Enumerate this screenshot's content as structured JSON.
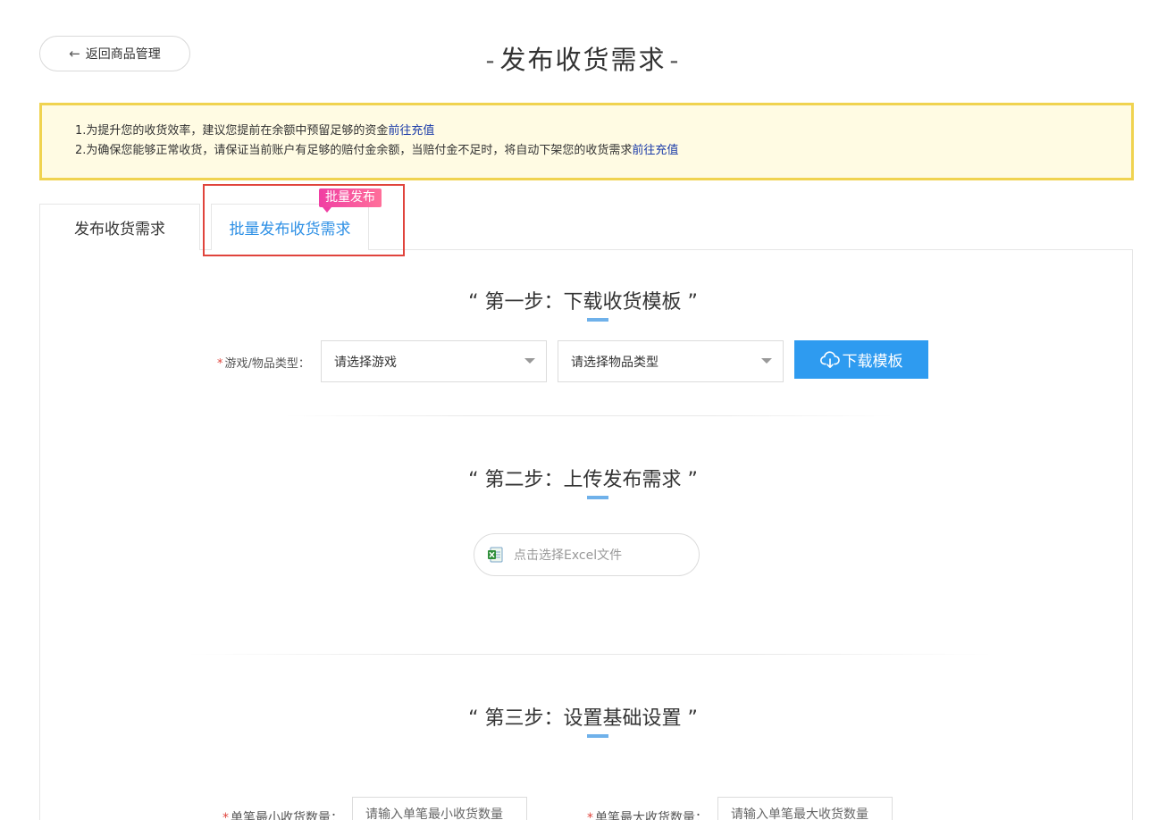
{
  "header": {
    "back_label": "返回商品管理",
    "title": "发布收货需求",
    "title_dash": "-"
  },
  "notice": {
    "line1_text": "1.为提升您的收货效率，建议您提前在余额中预留足够的资金",
    "line1_link": "前往充值",
    "line2_text": "2.为确保您能够正常收货，请保证当前账户有足够的赔付金余额，当赔付金不足时，将自动下架您的收货需求",
    "line2_link": "前往充值"
  },
  "tabs": [
    {
      "label": "发布收货需求",
      "active": false
    },
    {
      "label": "批量发布收货需求",
      "active": true
    }
  ],
  "badge": "批量发布",
  "step1": {
    "title": "“ 第一步：下载收货模板 ”",
    "label": "游戏/物品类型：",
    "required_mark": "*",
    "game_select": "请选择游戏",
    "item_select": "请选择物品类型",
    "download_label": "下载模板"
  },
  "step2": {
    "title": "“ 第二步：上传发布需求 ”",
    "upload_label": "点击选择Excel文件"
  },
  "step3": {
    "title": "“ 第三步：设置基础设置 ”",
    "min_label": "单笔最小收货数量：",
    "min_placeholder": "请输入单笔最小收货数量",
    "max_label": "单笔最大收货数量：",
    "max_placeholder": "请输入单笔最大收货数量",
    "required_mark": "*"
  },
  "colors": {
    "accent": "#2e9bf0",
    "tab_active": "#2c8fe5",
    "notice_border": "#f0d350",
    "notice_bg": "#fffbe3",
    "highlight": "#e0443c",
    "badge": "#f03fa3"
  },
  "icons": {
    "back": "arrow-left-icon",
    "download": "cloud-download-icon",
    "excel": "excel-file-icon",
    "caret": "caret-down-icon"
  }
}
